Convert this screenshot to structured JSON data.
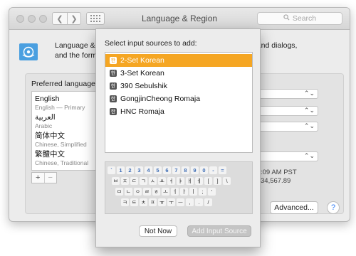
{
  "window": {
    "title": "Language & Region",
    "search_placeholder": "Search",
    "header_line1_left": "Language & F",
    "header_line1_right": "nus and dialogs,",
    "header_line2": "and the forma",
    "preferred_languages_label": "Preferred languages:",
    "languages": [
      {
        "name": "English",
        "sub": "English — Primary"
      },
      {
        "name": "العربية",
        "sub": "Arabic"
      },
      {
        "name": "简体中文",
        "sub": "Chinese, Simplified"
      },
      {
        "name": "繁體中文",
        "sub": "Chinese, Traditional"
      }
    ],
    "add_symbol": "+",
    "remove_symbol": "−",
    "time_text": ":09 AM PST",
    "number_text": "34,567.89",
    "advanced_label": "Advanced...",
    "help_label": "?"
  },
  "sheet": {
    "title": "Select input sources to add:",
    "sources": [
      {
        "label": "2-Set Korean",
        "selected": true
      },
      {
        "label": "3-Set Korean",
        "selected": false
      },
      {
        "label": "390 Sebulshik",
        "selected": false
      },
      {
        "label": "GongjinCheong Romaja",
        "selected": false
      },
      {
        "label": "HNC Romaja",
        "selected": false
      }
    ],
    "source_icon_glyph": "한",
    "keyboard": {
      "row1": [
        "`",
        "1",
        "2",
        "3",
        "4",
        "5",
        "6",
        "7",
        "8",
        "9",
        "0",
        "-",
        "="
      ],
      "row2": [
        "ㅂ",
        "ㅈ",
        "ㄷ",
        "ㄱ",
        "ㅅ",
        "ㅛ",
        "ㅕ",
        "ㅑ",
        "ㅐ",
        "ㅔ",
        "[",
        "]",
        "\\"
      ],
      "row3": [
        "ㅁ",
        "ㄴ",
        "ㅇ",
        "ㄹ",
        "ㅎ",
        "ㅗ",
        "ㅓ",
        "ㅏ",
        "ㅣ",
        ";",
        "'"
      ],
      "row4": [
        "ㅋ",
        "ㅌ",
        "ㅊ",
        "ㅍ",
        "ㅠ",
        "ㅜ",
        "ㅡ",
        ",",
        ".",
        "/"
      ]
    },
    "not_now_label": "Not Now",
    "add_label": "Add Input Source"
  },
  "colors": {
    "selection": "#f5a623",
    "help_accent": "#2f7cf6"
  }
}
